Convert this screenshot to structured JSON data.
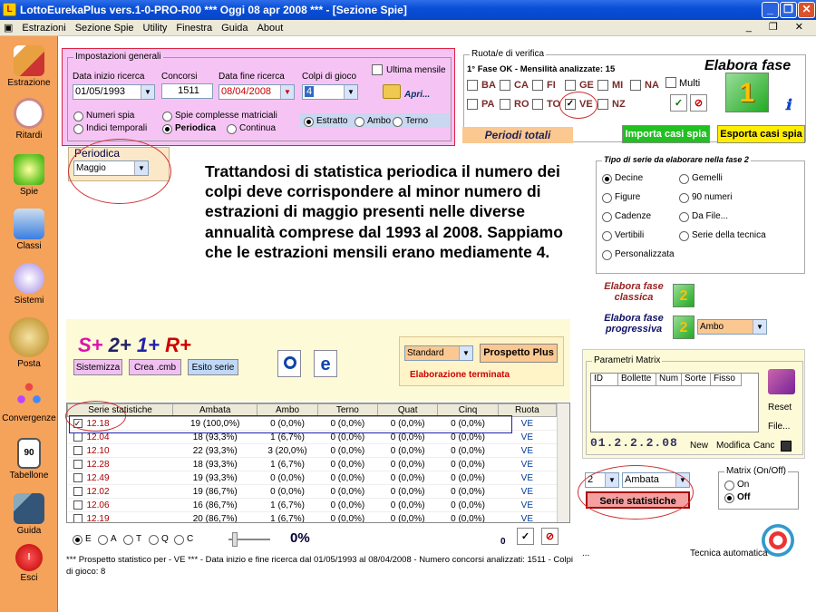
{
  "window": {
    "title": "LottoEurekaPlus vers.1-0-PRO-R00  ***  Oggi 08 apr 2008  ***  - [Sezione Spie]"
  },
  "menu": [
    "Estrazioni",
    "Sezione Spie",
    "Utility",
    "Finestra",
    "Guida",
    "About"
  ],
  "sidebar": [
    "Estrazione",
    "Ritardi",
    "Spie",
    "Classi",
    "Sistemi",
    "Posta",
    "Convergenze",
    "Tabellone",
    "Guida",
    "Esci"
  ],
  "sidebar_tabellone_num": "90",
  "settings": {
    "legend": "Impostazioni generali",
    "start_label": "Data inizio ricerca",
    "start_value": "01/05/1993",
    "concorsi_label": "Concorsi",
    "concorsi_value": "1511",
    "end_label": "Data fine ricerca",
    "end_value": "08/04/2008",
    "colpi_label": "Colpi di gioco",
    "colpi_value": "4",
    "ultima_label": "Ultima mensile",
    "apri_label": "Apri...",
    "opt_numeri_spia": "Numeri spia",
    "opt_indici": "Indici temporali",
    "opt_spie_compl": "Spie complesse matriciali",
    "opt_periodica": "Periodica",
    "opt_continua": "Continua",
    "opt_estratto": "Estratto",
    "opt_ambo": "Ambo",
    "opt_terno": "Terno"
  },
  "periodica": {
    "label": "Periodica",
    "value": "Maggio"
  },
  "note": "Trattandosi di statistica periodica il numero dei colpi deve corrispondere al minor numero di estrazioni di maggio presenti nelle diverse annualità comprese dal 1993 al 2008. Sappiamo che le estrazioni mensili erano mediamente 4.",
  "ruota": {
    "legend": "Ruota/e di verifica",
    "status": "1° Fase OK - Mensilità analizzate: 15",
    "row1": [
      "BA",
      "CA",
      "FI",
      "GE",
      "MI",
      "NA"
    ],
    "row2": [
      "PA",
      "RO",
      "TO",
      "VE",
      "NZ"
    ],
    "multi_label": "Multi",
    "elabora_title": "Elabora fase",
    "badge": "1"
  },
  "periodi_totali": "Periodi totali",
  "import_btn": "Importa casi spia",
  "export_btn": "Esporta casi spia",
  "tipo_serie": {
    "legend": "Tipo di serie da elaborare nella fase 2",
    "left": [
      "Decine",
      "Figure",
      "Cadenze",
      "Vertibili",
      "Personalizzata"
    ],
    "right": [
      "Gemelli",
      "90 numeri",
      "Da File...",
      "Serie della tecnica"
    ]
  },
  "elabora_classica": "Elabora fase classica",
  "elabora_progressiva": "Elabora fase progressiva",
  "badge2": "2",
  "progressiva_value": "Ambo",
  "panel": {
    "s": "S+",
    "n2": "2+",
    "n1": "1+",
    "r": "R+",
    "sistemizza": "Sistemizza",
    "crea": "Crea .cmb",
    "esito": "Esito serie",
    "standard": "Standard",
    "prospetto": "Prospetto Plus",
    "status": "Elaborazione terminata"
  },
  "table": {
    "headers": [
      "Serie statistiche",
      "Ambata",
      "Ambo",
      "Terno",
      "Quat",
      "Cinq",
      "Ruota"
    ],
    "rows": [
      [
        "12.18",
        "19 (100,0%)",
        "0 (0,0%)",
        "0 (0,0%)",
        "0 (0,0%)",
        "0 (0,0%)",
        "VE"
      ],
      [
        "12.04",
        "18 (93,3%)",
        "1 (6,7%)",
        "0 (0,0%)",
        "0 (0,0%)",
        "0 (0,0%)",
        "VE"
      ],
      [
        "12.10",
        "22 (93,3%)",
        "3 (20,0%)",
        "0 (0,0%)",
        "0 (0,0%)",
        "0 (0,0%)",
        "VE"
      ],
      [
        "12.28",
        "18 (93,3%)",
        "1 (6,7%)",
        "0 (0,0%)",
        "0 (0,0%)",
        "0 (0,0%)",
        "VE"
      ],
      [
        "12.49",
        "19 (93,3%)",
        "0 (0,0%)",
        "0 (0,0%)",
        "0 (0,0%)",
        "0 (0,0%)",
        "VE"
      ],
      [
        "12.02",
        "19 (86,7%)",
        "0 (0,0%)",
        "0 (0,0%)",
        "0 (0,0%)",
        "0 (0,0%)",
        "VE"
      ],
      [
        "12.06",
        "16 (86,7%)",
        "1 (6,7%)",
        "0 (0,0%)",
        "0 (0,0%)",
        "0 (0,0%)",
        "VE"
      ],
      [
        "12.19",
        "20 (86,7%)",
        "1 (6,7%)",
        "0 (0,0%)",
        "0 (0,0%)",
        "0 (0,0%)",
        "VE"
      ]
    ]
  },
  "filters": [
    "E",
    "A",
    "T",
    "Q",
    "C"
  ],
  "progress": "0%",
  "zero_label": "0",
  "footer": "*** Prospetto statistico per  - VE ***  - Data inizio e fine ricerca dal 01/05/1993 al 08/04/2008 - Numero concorsi analizzati: 1511 - Colpi di gioco: 8",
  "matrix": {
    "legend": "Parametri Matrix",
    "headers": [
      "ID",
      "Bollette",
      "Num",
      "Sorte",
      "Fisso"
    ],
    "reset": "Reset",
    "file": "File...",
    "code": "01.2.2.2.08",
    "nuova": "New",
    "modifica": "Modifica",
    "canc": "Canc"
  },
  "bottom_right": {
    "num_value": "2",
    "sorte_value": "Ambata",
    "serie_btn": "Serie statistiche",
    "onoff_legend": "Matrix (On/Off)",
    "on": "On",
    "off": "Off",
    "tecnica": "Tecnica automatica",
    "dots": "..."
  }
}
